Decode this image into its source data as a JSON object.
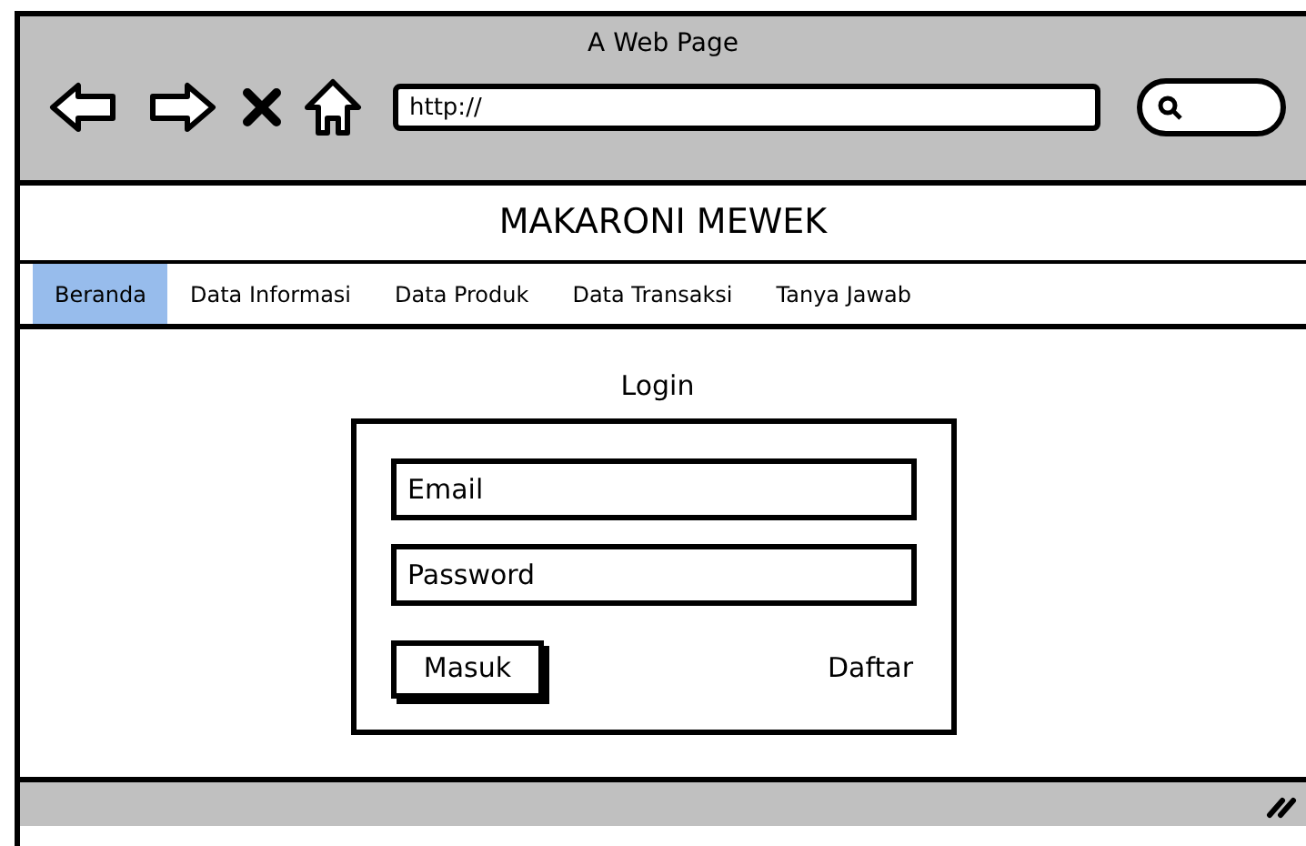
{
  "window": {
    "title": "A Web Page"
  },
  "address_bar": {
    "value": "http://"
  },
  "site_title": "MAKARONI MEWEK",
  "nav": [
    {
      "label": "Beranda",
      "selected": true
    },
    {
      "label": "Data Informasi",
      "selected": false
    },
    {
      "label": "Data Produk",
      "selected": false
    },
    {
      "label": "Data Transaksi",
      "selected": false
    },
    {
      "label": "Tanya Jawab",
      "selected": false
    }
  ],
  "login": {
    "heading": "Login",
    "email": {
      "value": "Email"
    },
    "password": {
      "value": "Password"
    },
    "submit": "Masuk",
    "register_link": "Daftar"
  }
}
